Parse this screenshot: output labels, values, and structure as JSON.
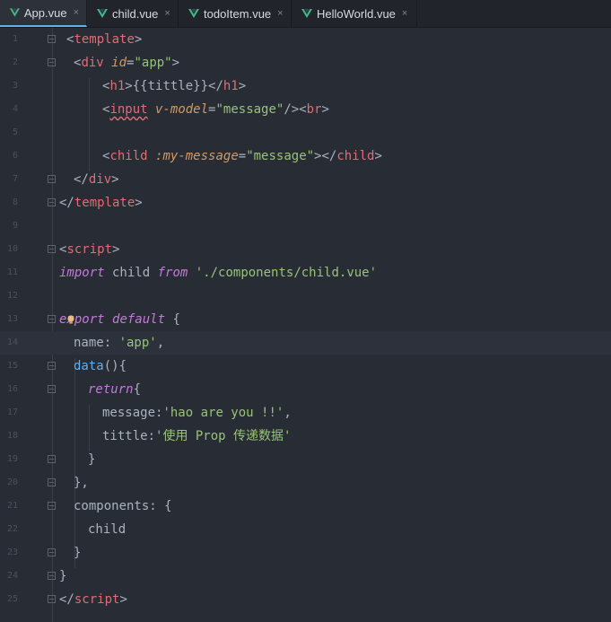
{
  "tabs": [
    {
      "label": "App.vue",
      "active": true
    },
    {
      "label": "child.vue",
      "active": false
    },
    {
      "label": "todoItem.vue",
      "active": false
    },
    {
      "label": "HelloWorld.vue",
      "active": false
    }
  ],
  "close_glyph": "×",
  "line_numbers": [
    "1",
    "2",
    "3",
    "4",
    "5",
    "6",
    "7",
    "8",
    "9",
    "10",
    "11",
    "12",
    "13",
    "14",
    "15",
    "16",
    "17",
    "18",
    "19",
    "20",
    "21",
    "22",
    "23",
    "24",
    "25"
  ],
  "code": {
    "l1": {
      "open": "<",
      "tag": "template",
      "close": ">"
    },
    "l2": {
      "open": "<",
      "tag": "div",
      "attr": "id",
      "eq": "=",
      "val": "\"app\"",
      "close": ">"
    },
    "l3": {
      "open": "<",
      "tag": "h1",
      "mid": ">{{tittle}}</",
      "tag2": "h1",
      "close": ">"
    },
    "l4": {
      "open": "<",
      "tag": "input",
      "attr": "v-model",
      "eq": "=",
      "val": "\"message\"",
      "mid": "/><",
      "tag2": "br",
      "close": ">"
    },
    "l6": {
      "open": "<",
      "tag": "child",
      "attr": ":my-message",
      "eq": "=",
      "val": "\"message\"",
      "mid": "></",
      "tag2": "child",
      "close": ">"
    },
    "l7": {
      "open": "</",
      "tag": "div",
      "close": ">"
    },
    "l8": {
      "open": "</",
      "tag": "template",
      "close": ">"
    },
    "l10": {
      "open": "<",
      "tag": "script",
      "close": ">"
    },
    "l11": {
      "kw": "import",
      "name": " child ",
      "kw2": "from",
      "sp": " ",
      "str": "'./components/child.vue'"
    },
    "l13": {
      "kw": "export",
      "sp": " ",
      "kw2": "default",
      "rest": " {"
    },
    "l14": {
      "key": "name",
      "colon": ": ",
      "str": "'app'",
      "rest": ","
    },
    "l15": {
      "fn": "data",
      "rest": "(){"
    },
    "l16": {
      "kw": "return",
      "rest": "{"
    },
    "l17": {
      "key": "message",
      "colon": ":",
      "str": "'hao are you !!'",
      "rest": ","
    },
    "l18": {
      "key": "tittle",
      "colon": ":",
      "str": "'使用 Prop 传递数据'"
    },
    "l19": {
      "text": "}"
    },
    "l20": {
      "text": "},"
    },
    "l21": {
      "key": "components",
      "colon": ": ",
      "rest": "{"
    },
    "l22": {
      "text": "child"
    },
    "l23": {
      "text": "}"
    },
    "l24": {
      "text": "}"
    },
    "l25": {
      "open": "</",
      "tag": "script",
      "close": ">"
    }
  },
  "colors": {
    "background": "#282c34",
    "tag": "#e06c75",
    "attribute": "#d19a66",
    "string": "#98c379",
    "keyword": "#c678dd",
    "tab_accent": "#61afef",
    "vue_logo": "#41b883"
  },
  "icons": [
    "vue-file-icon",
    "close-icon",
    "fold-marker-icon",
    "lightbulb-icon"
  ]
}
